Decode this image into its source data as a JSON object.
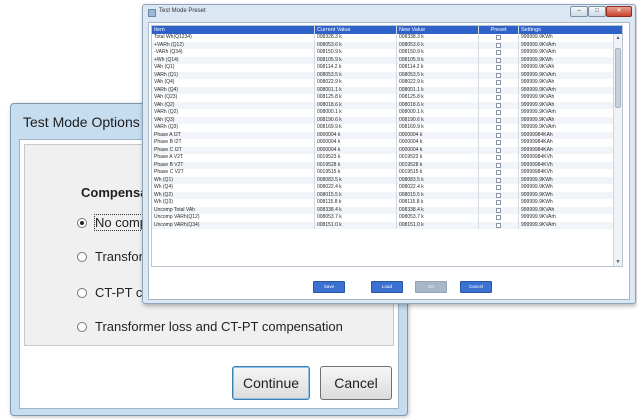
{
  "options_dialog": {
    "title": "Test Mode Options",
    "heading": "Compensat",
    "radio_options": [
      {
        "label": "No compe",
        "selected": true
      },
      {
        "label": "Transform",
        "selected": false
      },
      {
        "label": "CT-PT cor",
        "selected": false
      },
      {
        "label": "Transformer loss and CT-PT compensation",
        "selected": false
      }
    ],
    "continue_label": "Continue",
    "cancel_label": "Cancel"
  },
  "preset_window": {
    "title": "Test Mode Preset",
    "caption_buttons": {
      "minimize": "–",
      "maximize": "□",
      "close": "✕"
    },
    "columns": [
      "Item",
      "Current Value",
      "New Value",
      "Preset",
      "Settings"
    ],
    "rows": [
      [
        "Total Wh(Q1234)",
        "008328.3 k",
        "008338.3 k",
        "999999.9KWh"
      ],
      [
        "+VARh (Q12)",
        "008053.6 k",
        "008053.6 k",
        "999999.9KVArh"
      ],
      [
        "-VARh (Q34)",
        "008150.9 k",
        "008150.9 k",
        "999999.9KVArh"
      ],
      [
        "+Wh (Q14)",
        "008105.9 k",
        "008105.9 k",
        "999999.9KWh"
      ],
      [
        "VAh (Q1)",
        "008114.2 k",
        "008114.2 k",
        "999999.9KVAh"
      ],
      [
        "VARh (Q1)",
        "008053.5 k",
        "008053.5 k",
        "999999.9KVArh"
      ],
      [
        "VAh (Q4)",
        "008022.9 k",
        "008022.9 k",
        "999999.9KVAh"
      ],
      [
        "VARh (Q4)",
        "008001.1 k",
        "008001.1 k",
        "999999.9KVArh"
      ],
      [
        "VAh (Q23)",
        "008125.8 k",
        "008125.8 k",
        "999999.9KVAh"
      ],
      [
        "VAh (Q2)",
        "008018.6 k",
        "008018.6 k",
        "999999.9KVAh"
      ],
      [
        "VARh (Q2)",
        "008000.1 k",
        "008000.1 k",
        "999999.9KVArh"
      ],
      [
        "VAh (Q3)",
        "008190.6 k",
        "008190.6 k",
        "999999.9KVAh"
      ],
      [
        "VARh (Q3)",
        "008169.9 k",
        "008169.9 k",
        "999999.9KVArh"
      ],
      [
        "Phase A I2T",
        "0000004 k",
        "0000004 k",
        "99999984KAh"
      ],
      [
        "Phase B I2T",
        "0000004 k",
        "0000004 k",
        "99999984KAh"
      ],
      [
        "Phase C I2T",
        "0000004 k",
        "0000004 k",
        "99999984KAh"
      ],
      [
        "Phase A V2T",
        "0019523 k",
        "0019523 k",
        "99999984KVh"
      ],
      [
        "Phase B V2T",
        "0019528 k",
        "0019528 k",
        "99999984KVh"
      ],
      [
        "Phase C V2T",
        "0019515 k",
        "0019515 k",
        "99999984KVh"
      ],
      [
        "Wh (Q1)",
        "008083.5 k",
        "008083.5 k",
        "999999.9KWh"
      ],
      [
        "Wh (Q4)",
        "008022.4 k",
        "008022.4 k",
        "999999.9KWh"
      ],
      [
        "Wh (Q2)",
        "008015.5 k",
        "008015.5 k",
        "999999.9KWh"
      ],
      [
        "Wh (Q3)",
        "008115.8 k",
        "008115.8 k",
        "999999.9KWh"
      ],
      [
        "Uncomp Total VAh",
        "008338.4 k",
        "008338.4 k",
        "999999.9KVAh"
      ],
      [
        "Uncomp VARh(Q12)",
        "008053.7 k",
        "008053.7 k",
        "999999.9KVArh"
      ],
      [
        "Uncomp VARh(Q34)",
        "008151.0 k",
        "008151.0 k",
        "999999.9KVArh"
      ]
    ],
    "buttons": [
      {
        "label": "Save",
        "disabled": false
      },
      {
        "label": "Load",
        "disabled": false
      },
      {
        "label": "Set",
        "disabled": true
      },
      {
        "label": "Cancel",
        "disabled": false
      }
    ]
  },
  "colors": {
    "header_blue": "#2f62c8",
    "button_blue": "#3b72d1",
    "dialog_frame": "#c6dcef"
  }
}
